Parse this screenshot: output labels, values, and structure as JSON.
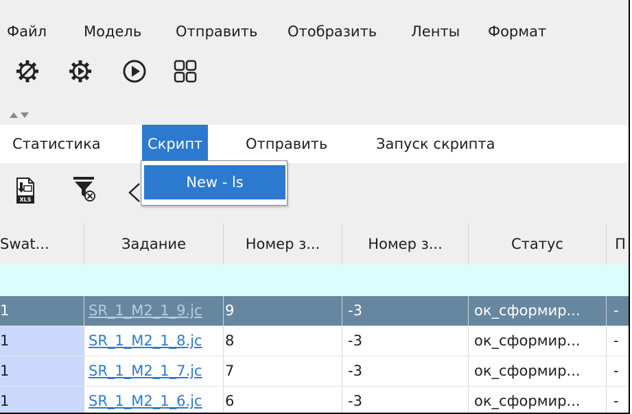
{
  "menu": {
    "items": [
      {
        "label": "Файл"
      },
      {
        "label": "Модель"
      },
      {
        "label": "Отправить"
      },
      {
        "label": "Отобразить"
      },
      {
        "label": "Ленты"
      },
      {
        "label": "Формат"
      }
    ]
  },
  "toolbar": {
    "icons": [
      "magic-gear-icon",
      "gear-play-icon",
      "play-circle-icon",
      "grid-icon"
    ]
  },
  "tabs": [
    {
      "label": "Статистика"
    },
    {
      "label": "Скрипт",
      "active": true
    },
    {
      "label": "Отправить"
    },
    {
      "label": "Запуск скрипта"
    }
  ],
  "dropdown": {
    "item": "New - ls"
  },
  "ribbon": {
    "icons": [
      "xls-export-icon",
      "filter-clear-icon"
    ]
  },
  "table": {
    "headers": [
      "Swat...",
      "Задание",
      "Номер з...",
      "Номер з...",
      "Статус",
      "П"
    ],
    "rows": [
      {
        "swath": "1",
        "task": "SR_1_M2_1_9.jc",
        "num1": "9",
        "num2": "-3",
        "status": "ок_сформир...",
        "extra": "-",
        "selected": true
      },
      {
        "swath": "1",
        "task": "SR_1_M2_1_8.jc",
        "num1": "8",
        "num2": "-3",
        "status": "ок_сформир...",
        "extra": "-"
      },
      {
        "swath": "1",
        "task": "SR_1_M2_1_7.jc",
        "num1": "7",
        "num2": "-3",
        "status": "ок_сформир...",
        "extra": "-"
      },
      {
        "swath": "1",
        "task": "SR_1_M2_1_6.jc",
        "num1": "6",
        "num2": "-3",
        "status": "ок_сформир...",
        "extra": "-"
      }
    ]
  },
  "colors": {
    "accent": "#2c7ad0",
    "selected_row": "#66879f",
    "filter_row": "#dcfdfd",
    "swath_cell": "#cad8fb"
  }
}
